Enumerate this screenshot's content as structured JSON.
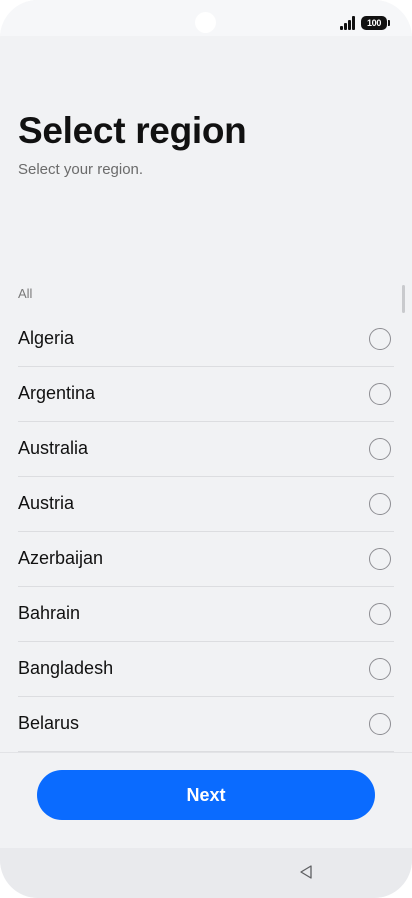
{
  "status_bar": {
    "battery_level": "100",
    "signal_icon": "signal-bars-icon"
  },
  "header": {
    "title": "Select region",
    "subtitle": "Select your region."
  },
  "list": {
    "section_label": "All",
    "items": [
      {
        "label": "Algeria",
        "selected": false
      },
      {
        "label": "Argentina",
        "selected": false
      },
      {
        "label": "Australia",
        "selected": false
      },
      {
        "label": "Austria",
        "selected": false
      },
      {
        "label": "Azerbaijan",
        "selected": false
      },
      {
        "label": "Bahrain",
        "selected": false
      },
      {
        "label": "Bangladesh",
        "selected": false
      },
      {
        "label": "Belarus",
        "selected": false
      }
    ]
  },
  "footer": {
    "next_label": "Next"
  },
  "nav_bar": {
    "back_icon": "back-triangle-icon"
  },
  "colors": {
    "accent": "#0a6bff",
    "background": "#f1f2f4"
  }
}
